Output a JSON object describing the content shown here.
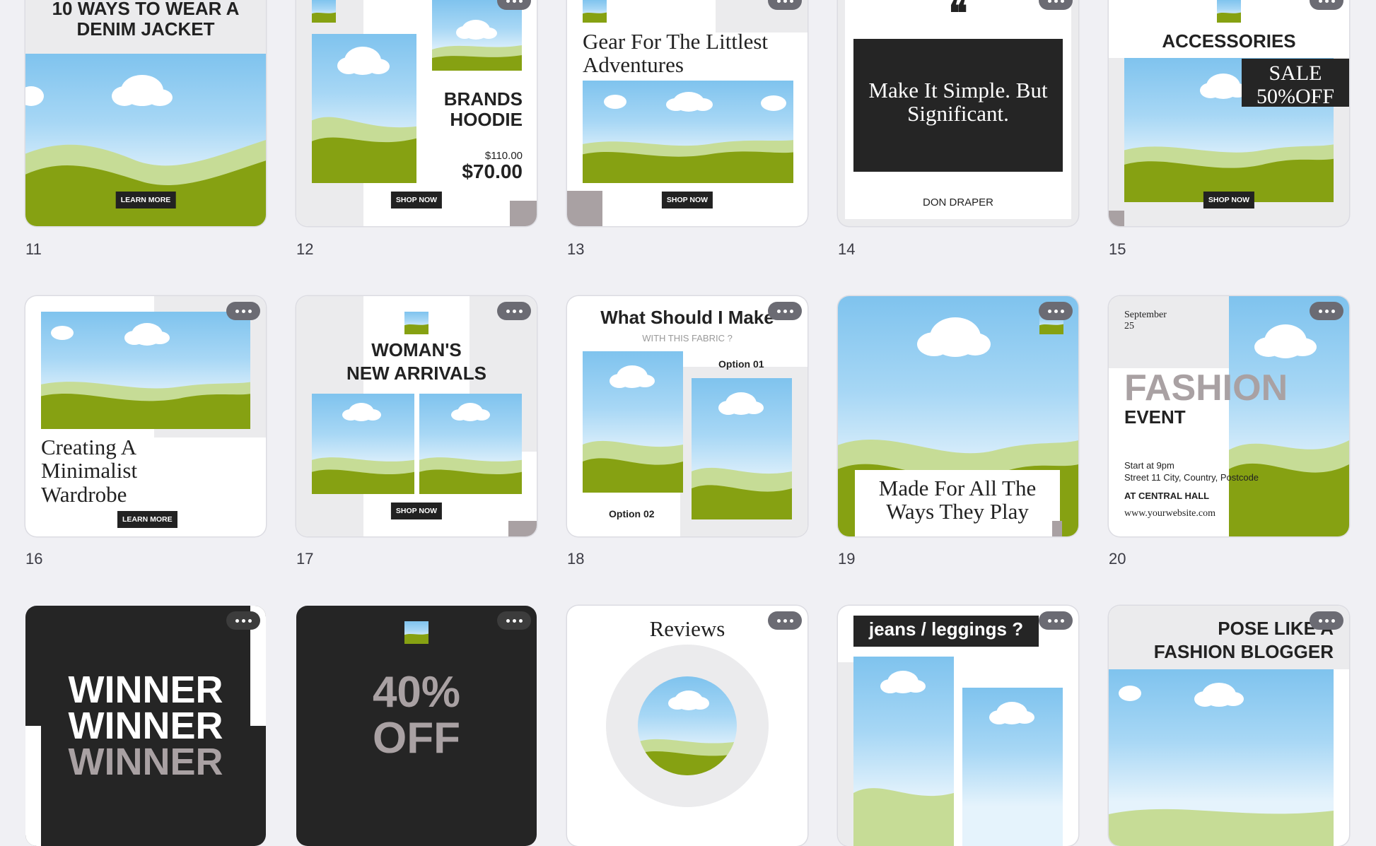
{
  "cards": {
    "c11": {
      "number": "11",
      "title": "10 WAYS TO WEAR A DENIM JACKET",
      "button": "LEARN MORE"
    },
    "c12": {
      "number": "12",
      "title": "BRANDS HOODIE",
      "old_price": "$110.00",
      "new_price": "$70.00",
      "button": "SHOP NOW"
    },
    "c13": {
      "number": "13",
      "title": "Gear For The Littlest Adventures",
      "button": "SHOP NOW"
    },
    "c14": {
      "number": "14",
      "quote_mark": "❝",
      "quote": "Make It Simple. But Significant.",
      "author": "DON DRAPER"
    },
    "c15": {
      "number": "15",
      "title": "ACCESSORIES",
      "sale_line1": "SALE",
      "sale_line2": "50%OFF",
      "button": "SHOP NOW"
    },
    "c16": {
      "number": "16",
      "title": "Creating A Minimalist Wardrobe",
      "button": "LEARN MORE"
    },
    "c17": {
      "number": "17",
      "title_line1": "WOMAN'S",
      "title_line2": "NEW ARRIVALS",
      "button": "SHOP NOW"
    },
    "c18": {
      "number": "18",
      "title": "What Should I Make",
      "subtitle": "WITH THIS FABRIC ?",
      "option1": "Option 01",
      "option2": "Option 02"
    },
    "c19": {
      "number": "19",
      "title": "Made For All The Ways They Play"
    },
    "c20": {
      "number": "20",
      "date_line1": "September",
      "date_line2": "25",
      "title": "FASHION",
      "subtitle": "EVENT",
      "time": "Start at 9pm",
      "address": "Street 11 City, Country, Postcode",
      "venue": "AT CENTRAL HALL",
      "website": "www.yourwebsite.com"
    },
    "c21": {
      "line1": "WINNER",
      "line2": "WINNER",
      "line3": "WINNER"
    },
    "c22": {
      "line1": "40%",
      "line2": "OFF"
    },
    "c23": {
      "title": "Reviews"
    },
    "c24": {
      "title": "jeans / leggings ?"
    },
    "c25": {
      "title_line1": "POSE LIKE A",
      "title_line2": "FASHION BLOGGER"
    }
  },
  "icons": {
    "more": "more-options-icon",
    "image_placeholder": "image-placeholder-icon",
    "quote": "quote-icon"
  },
  "colors": {
    "background": "#f0f0f4",
    "dark_card": "#252525",
    "button": "#222222",
    "accent_taupe": "#a9a1a3",
    "hill_dark": "#86a112",
    "hill_light": "#c6dc96",
    "sky": "#8ccbf0"
  }
}
